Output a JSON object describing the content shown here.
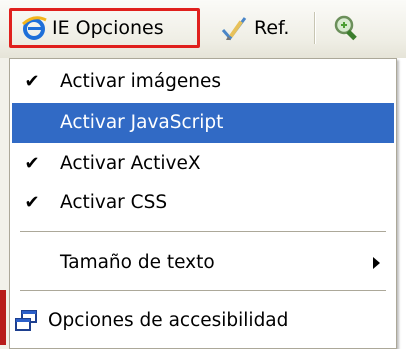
{
  "toolbar": {
    "ie_options_label": "IE Opciones",
    "ref_label": "Ref."
  },
  "menu": {
    "items": [
      {
        "label": "Activar imágenes",
        "checked": true
      },
      {
        "label": "Activar JavaScript",
        "checked": false,
        "highlighted": true
      },
      {
        "label": "Activar ActiveX",
        "checked": true
      },
      {
        "label": "Activar CSS",
        "checked": true
      },
      {
        "label": "Tamaño de texto",
        "submenu": true
      },
      {
        "label": "Opciones de accesibilidad",
        "icon": "windows-icon"
      }
    ],
    "check_glyph": "✔"
  },
  "colors": {
    "highlight": "#316ac5",
    "ie_button_border": "#e0201d"
  }
}
